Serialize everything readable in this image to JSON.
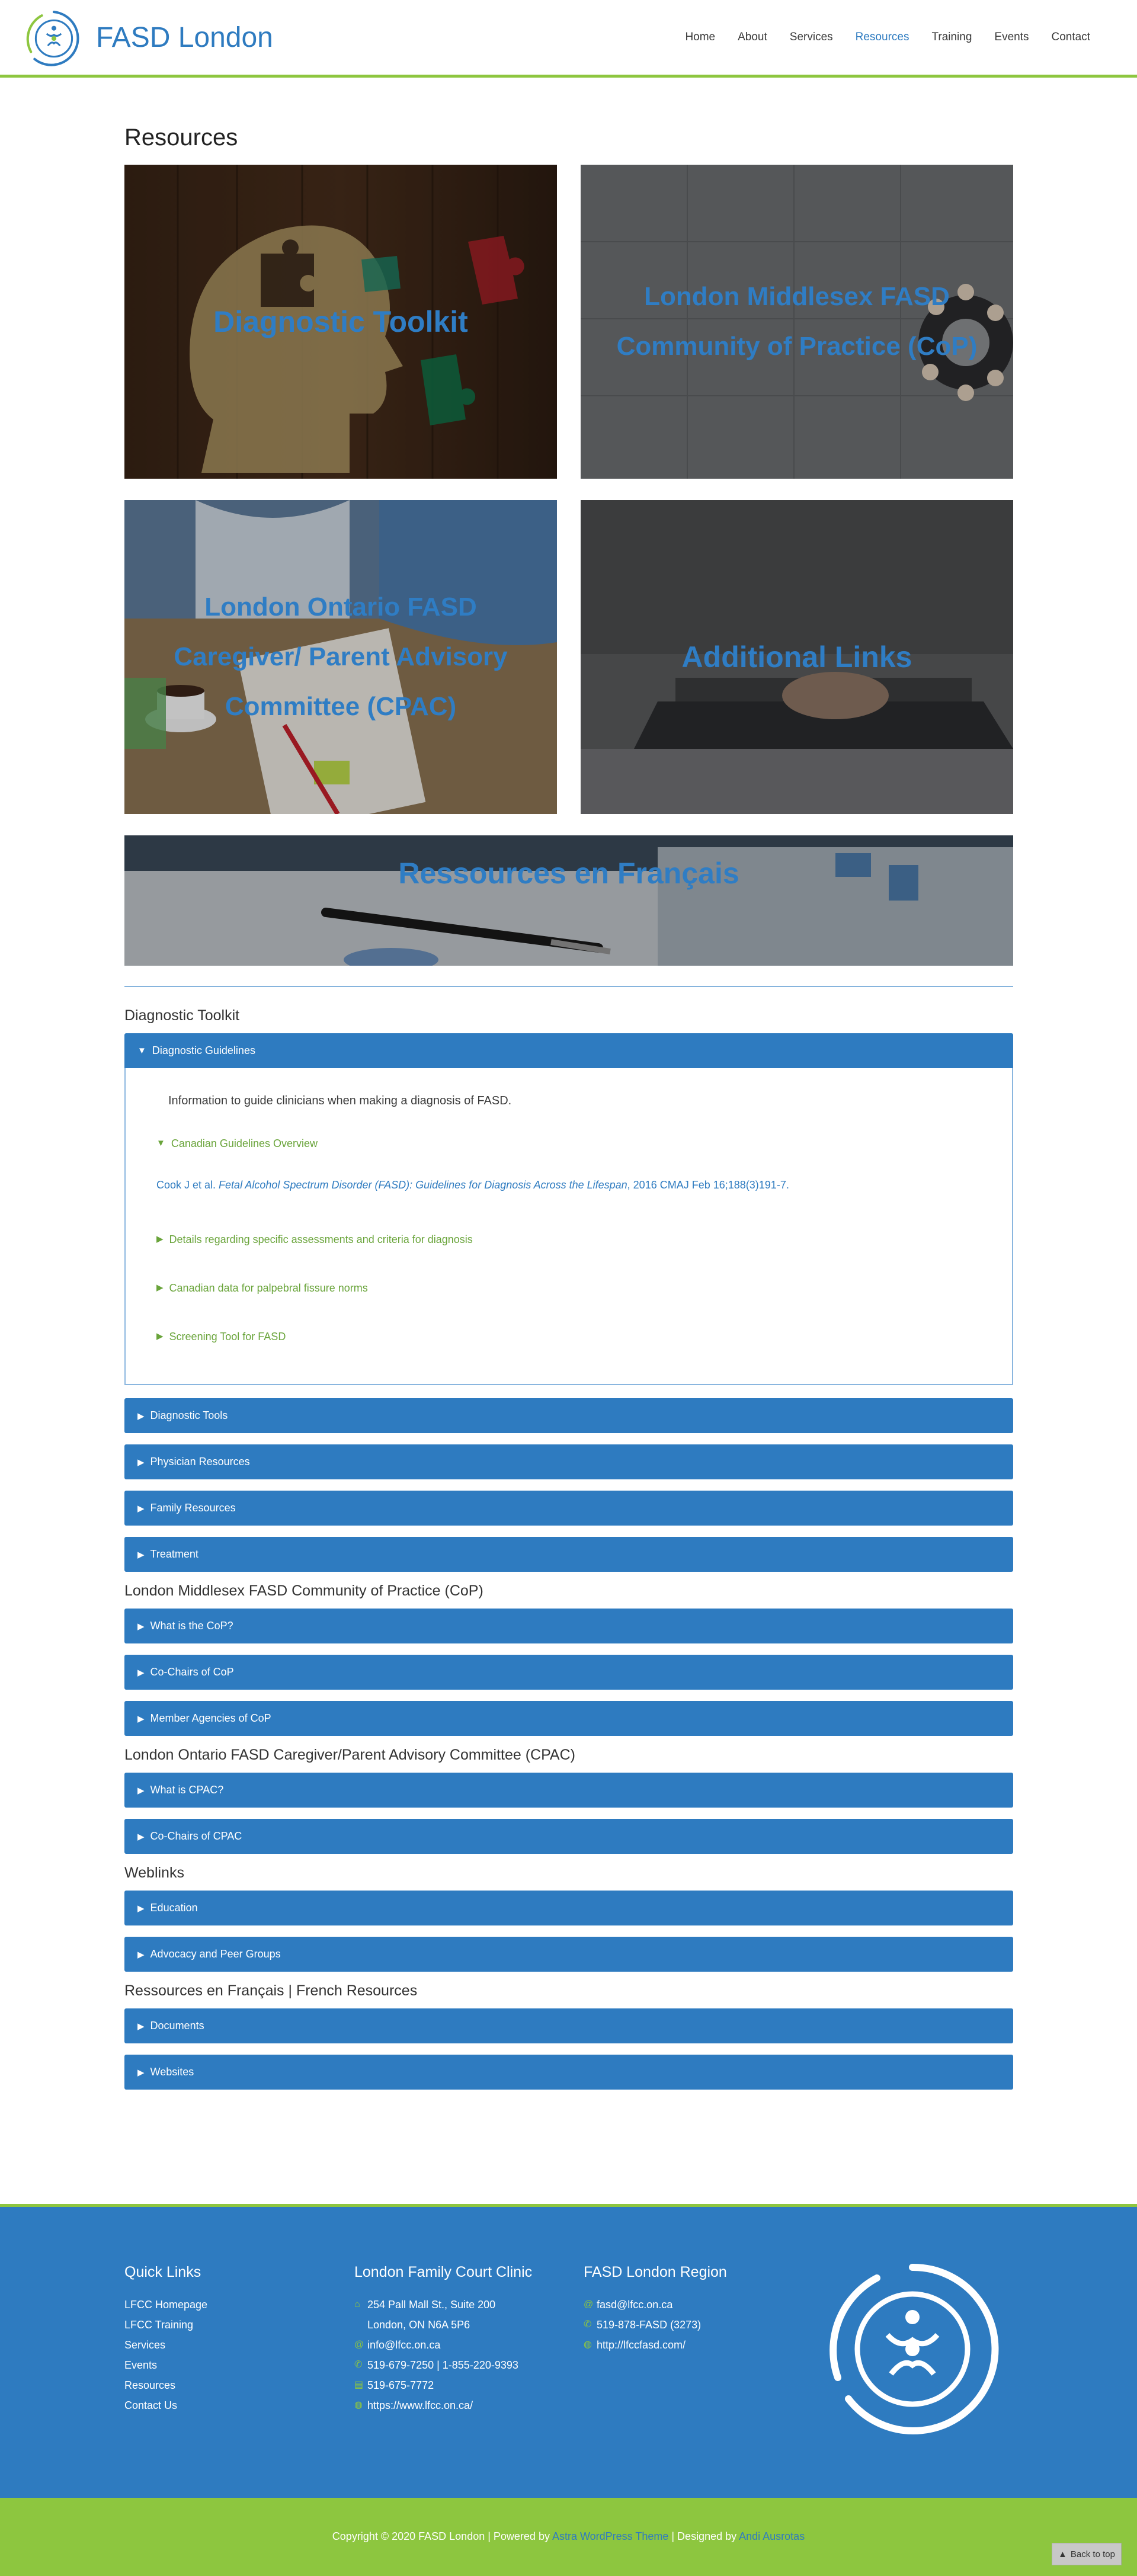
{
  "header": {
    "site_title": "FASD London",
    "nav": [
      {
        "label": "Home",
        "active": false
      },
      {
        "label": "About",
        "active": false
      },
      {
        "label": "Services",
        "active": false
      },
      {
        "label": "Resources",
        "active": true
      },
      {
        "label": "Training",
        "active": false
      },
      {
        "label": "Events",
        "active": false
      },
      {
        "label": "Contact",
        "active": false
      }
    ]
  },
  "page": {
    "title": "Resources",
    "tiles": [
      {
        "label": "Diagnostic Toolkit"
      },
      {
        "label": "London Middlesex FASD Community of Practice (CoP)"
      },
      {
        "label": "London Ontario FASD Caregiver/ Parent Advisory Committee (CPAC)"
      },
      {
        "label": "Additional Links"
      }
    ],
    "wide_tile": {
      "label": "Ressources en Français"
    }
  },
  "sections": {
    "diagnostic": {
      "heading": "Diagnostic Toolkit",
      "open_item": "Diagnostic Guidelines",
      "intro": "Information to guide clinicians when making a diagnosis of FASD.",
      "open_sub": "Canadian Guidelines Overview",
      "citation_authors": "Cook J et al. ",
      "citation_title": "Fetal Alcohol Spectrum Disorder (FASD): Guidelines for Diagnosis Across the Lifespan",
      "citation_rest": ", 2016 CMAJ Feb 16;188(3)191-7.",
      "subs": [
        "Details regarding specific assessments and criteria for diagnosis",
        "Canadian data for palpebral fissure norms",
        "Screening Tool for FASD"
      ],
      "items": [
        "Diagnostic Tools",
        "Physician Resources",
        "Family Resources",
        "Treatment"
      ]
    },
    "cop": {
      "heading": "London Middlesex FASD Community of Practice (CoP)",
      "items": [
        "What is the CoP?",
        "Co-Chairs of CoP",
        "Member Agencies of CoP"
      ]
    },
    "cpac": {
      "heading": "London Ontario FASD Caregiver/Parent Advisory Committee (CPAC)",
      "items": [
        "What is CPAC?",
        "Co-Chairs of CPAC"
      ]
    },
    "weblinks": {
      "heading": "Weblinks",
      "items": [
        "Education",
        "Advocacy and Peer Groups"
      ]
    },
    "french": {
      "heading": "Ressources en Français | French Resources",
      "items": [
        "Documents",
        "Websites"
      ]
    }
  },
  "footer": {
    "quick_links": {
      "heading": "Quick Links",
      "links": [
        "LFCC Homepage",
        "LFCC Training",
        "Services",
        "Events",
        "Resources",
        "Contact Us"
      ]
    },
    "lfcc": {
      "heading": "London Family Court Clinic",
      "address1": "254 Pall Mall St., Suite 200",
      "address2": "London, ON N6A 5P6",
      "email": "info@lfcc.on.ca",
      "phone": "519-679-7250 | 1-855-220-9393",
      "fax": "519-675-7772",
      "web": "https://www.lfcc.on.ca/"
    },
    "region": {
      "heading": "FASD London Region",
      "email": "fasd@lfcc.on.ca",
      "phone": "519-878-FASD (3273)",
      "web": "http://lfccfasd.com/"
    },
    "copyright_prefix": "Copyright © 2020 FASD London | Powered by ",
    "theme_link": "Astra WordPress Theme",
    "designed_by": " | Designed by ",
    "designer": "Andi Ausrotas",
    "back_to_top": "Back to top"
  },
  "colors": {
    "brand_blue": "#2e7bc0",
    "brand_green": "#8dc63f",
    "sub_green": "#69a43a"
  }
}
